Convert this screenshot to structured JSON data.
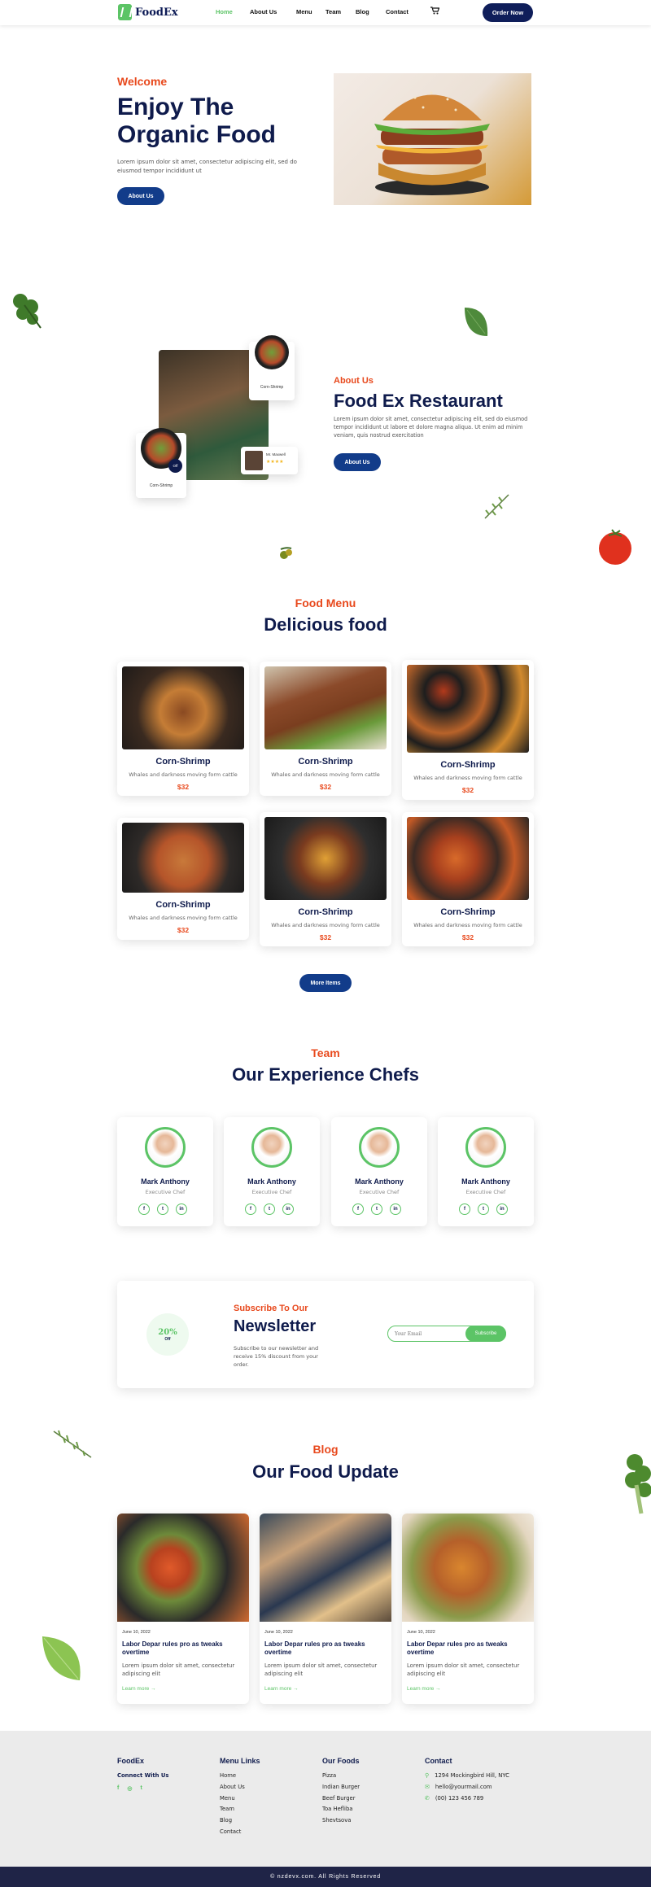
{
  "header": {
    "logo_text": "FoodEx",
    "nav": [
      "Home",
      "About Us",
      "Menu",
      "Team",
      "Blog",
      "Contact"
    ],
    "cart_icon": "cart-icon",
    "order_button": "Order Now",
    "active_color": "#5cc466"
  },
  "hero": {
    "welcome": "Welcome",
    "title": "Enjoy The Organic Food",
    "description": "Lorem ipsum dolor sit amet, consectetur adipiscing elit, sed do eiusmod tempor incididunt ut",
    "button": "About Us"
  },
  "about": {
    "card_label_1": "Corn-Shrimp",
    "card_label_2": "Corn-Shrimp",
    "badge": "Off",
    "reviewer": "Mr. Maxwell",
    "stars": "★★★★",
    "subtitle": "About Us",
    "title": "Food Ex Restaurant",
    "description": "Lorem ipsum dolor sit amet, consectetur adipiscing elit, sed do eiusmod tempor incididunt ut labore et dolore magna aliqua. Ut enim ad minim veniam, quis nostrud exercitation",
    "button": "About Us"
  },
  "menu": {
    "subtitle": "Food Menu",
    "title": "Delicious food",
    "items": [
      {
        "name": "Corn-Shrimp",
        "desc": "Whales and darkness moving form cattle",
        "price": "$32"
      },
      {
        "name": "Corn-Shrimp",
        "desc": "Whales and darkness moving form cattle",
        "price": "$32"
      },
      {
        "name": "Corn-Shrimp",
        "desc": "Whales and darkness moving form cattle",
        "price": "$32"
      },
      {
        "name": "Corn-Shrimp",
        "desc": "Whales and darkness moving form cattle",
        "price": "$32"
      },
      {
        "name": "Corn-Shrimp",
        "desc": "Whales and darkness moving form cattle",
        "price": "$32"
      },
      {
        "name": "Corn-Shrimp",
        "desc": "Whales and darkness moving form cattle",
        "price": "$32"
      }
    ],
    "more_button": "More Items"
  },
  "team": {
    "subtitle": "Team",
    "title": "Our Experience Chefs",
    "chefs": [
      {
        "name": "Mark Anthony",
        "role": "Executive Chef"
      },
      {
        "name": "Mark Anthony",
        "role": "Executive Chef"
      },
      {
        "name": "Mark Anthony",
        "role": "Executive Chef"
      },
      {
        "name": "Mark Anthony",
        "role": "Executive Chef"
      }
    ],
    "social": [
      "f",
      "t",
      "in"
    ]
  },
  "newsletter": {
    "badge_percent": "20%",
    "badge_off": "Off",
    "subtitle": "Subscribe To Our",
    "title": "Newsletter",
    "description": "Subscribe to our newsletter and receive 15% discount from your order.",
    "placeholder": "Your Email",
    "button": "Subscribe"
  },
  "blog": {
    "subtitle": "Blog",
    "title": "Our Food Update",
    "posts": [
      {
        "date": "June 10, 2022",
        "title": "Labor Depar rules pro as tweaks overtime",
        "desc": "Lorem ipsum dolor sit amet, consectetur adipiscing elit",
        "link": "Learn more →"
      },
      {
        "date": "June 10, 2022",
        "title": "Labor Depar rules pro as tweaks overtime",
        "desc": "Lorem ipsum dolor sit amet, consectetur adipiscing elit",
        "link": "Learn more →"
      },
      {
        "date": "June 10, 2022",
        "title": "Labor Depar rules pro as tweaks overtime",
        "desc": "Lorem ipsum dolor sit amet, consectetur adipiscing elit",
        "link": "Learn more →"
      }
    ]
  },
  "footer": {
    "brand": "FoodEx",
    "connect": "Connect With Us",
    "social": [
      "f",
      "◎",
      "t"
    ],
    "menu_heading": "Menu Links",
    "menu_links": [
      "Home",
      "About Us",
      "Menu",
      "Team",
      "Blog",
      "Contact"
    ],
    "foods_heading": "Our Foods",
    "foods": [
      "Pizza",
      "Indian Burger",
      "Beef Burger",
      "Toa Hefliba",
      "Shevtsova"
    ],
    "contact_heading": "Contact",
    "contacts": [
      {
        "icon": "location-icon",
        "text": "1294 Mockingbird Hill, NYC"
      },
      {
        "icon": "mail-icon",
        "text": "hello@yourmail.com"
      },
      {
        "icon": "phone-icon",
        "text": "(00) 123 456 789"
      }
    ],
    "copyright": "© nzdevx.com. All Rights Reserved"
  }
}
